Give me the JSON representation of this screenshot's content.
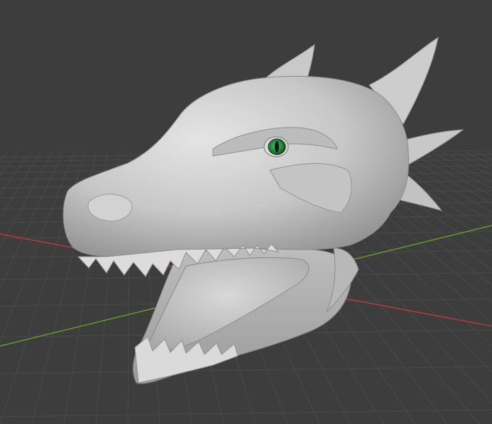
{
  "viewport": {
    "background": "#3d3d3d",
    "grid_color": "#4a4a4a",
    "x_axis_color": "#b83a3a",
    "y_axis_color": "#6a9a2a",
    "model": {
      "type": "sculpted-dragon-head",
      "material_color": "#cfcfcf",
      "eye_color": "#1f7a3a"
    }
  }
}
